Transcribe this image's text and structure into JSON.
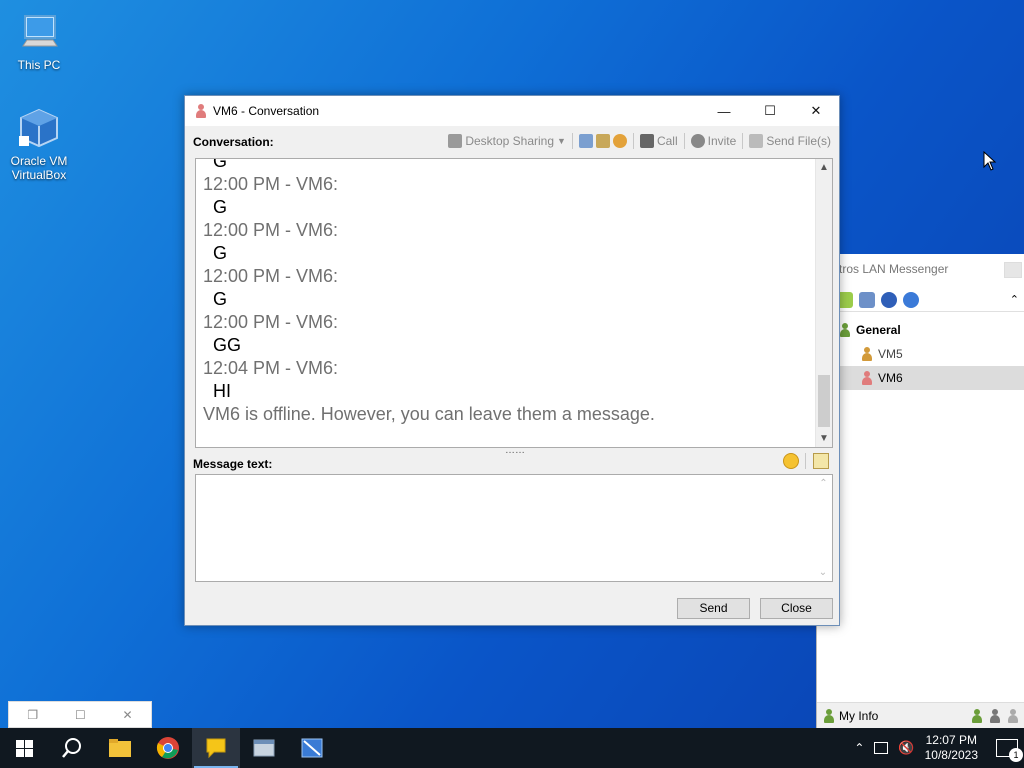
{
  "desktop": {
    "icons": [
      {
        "label": "This PC"
      },
      {
        "label": "Oracle VM VirtualBox"
      }
    ]
  },
  "main_window": {
    "title": "Ostros LAN Messenger",
    "title_visible": "tros LAN Messenger",
    "group": "General",
    "users": [
      {
        "name": "VM5",
        "color": "#d29a3a"
      },
      {
        "name": "VM6",
        "color": "#e07c7c"
      }
    ],
    "status_label": "My Info"
  },
  "conversation": {
    "title": "VM6 - Conversation",
    "conversation_label": "Conversation:",
    "toolbar": {
      "desktop_sharing": "Desktop Sharing",
      "call": "Call",
      "invite": "Invite",
      "send_files": "Send File(s)"
    },
    "messages": [
      {
        "head": "12:00 PM - VM6:",
        "body": "G"
      },
      {
        "head": "12:00 PM - VM6:",
        "body": "G"
      },
      {
        "head": "12:00 PM - VM6:",
        "body": "G"
      },
      {
        "head": "12:00 PM - VM6:",
        "body": "GG"
      },
      {
        "head": "12:04 PM - VM6:",
        "body": "HI"
      }
    ],
    "partial_top": "G",
    "offline_note": "VM6 is offline. However, you can leave them a message.",
    "message_text_label": "Message text:",
    "message_value": "",
    "send_label": "Send",
    "close_label": "Close"
  },
  "taskbar": {
    "time": "12:07 PM",
    "date": "10/8/2023",
    "notification_count": "1"
  },
  "colors": {
    "desktop_blue": "#0a55c8",
    "taskbar": "#101820",
    "selected_row": "#dcdcdc"
  }
}
